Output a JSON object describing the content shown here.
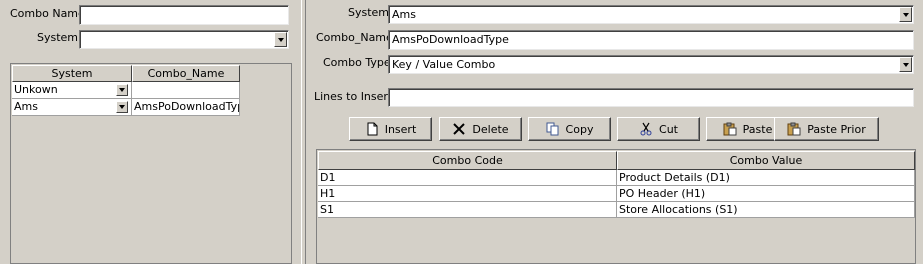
{
  "left": {
    "combo_name_label": "Combo Name",
    "combo_name_value": "",
    "system_label": "System",
    "system_value": "",
    "grid": {
      "headers": [
        "System",
        "Combo_Name"
      ],
      "rows": [
        {
          "system": "Unkown",
          "combo_name": ""
        },
        {
          "system": "Ams",
          "combo_name": "AmsPoDownloadType"
        }
      ]
    }
  },
  "right": {
    "system_label": "System",
    "system_value": "Ams",
    "combo_name_label": "Combo_Name",
    "combo_name_value": "AmsPoDownloadType",
    "combo_type_label": "Combo Type",
    "combo_type_value": "Key / Value Combo",
    "lines_label": "Lines to Insert",
    "lines_value": "",
    "buttons": {
      "insert": "Insert",
      "delete": "Delete",
      "copy": "Copy",
      "cut": "Cut",
      "paste": "Paste",
      "paste_prior": "Paste Prior"
    },
    "grid": {
      "headers": [
        "Combo Code",
        "Combo Value"
      ],
      "rows": [
        {
          "code": "D1",
          "value": "Product Details (D1)"
        },
        {
          "code": "H1",
          "value": "PO Header (H1)"
        },
        {
          "code": "S1",
          "value": "Store Allocations (S1)"
        }
      ]
    }
  },
  "icons": [
    "document-icon",
    "delete-x-icon",
    "copy-icon",
    "scissors-icon",
    "paste-icon",
    "paste-prior-icon"
  ]
}
